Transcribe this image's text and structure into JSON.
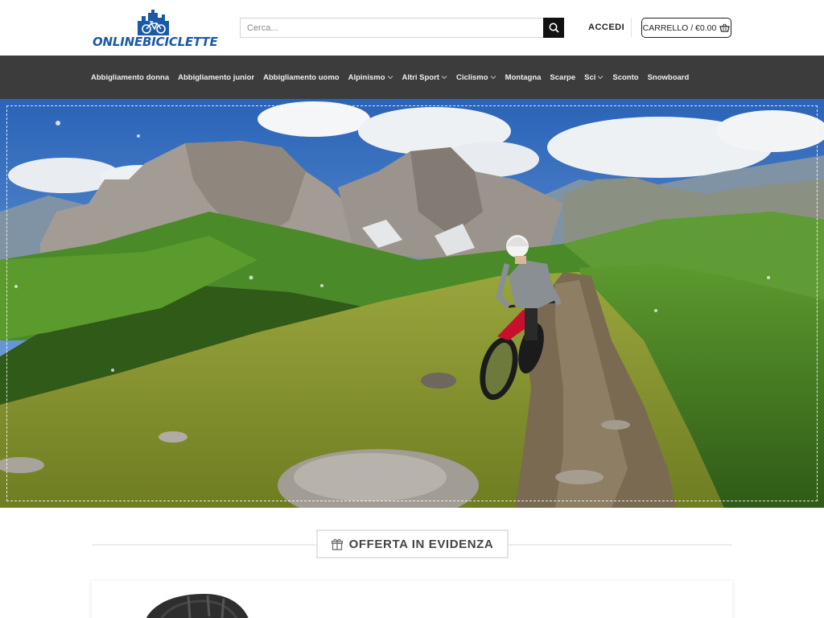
{
  "header": {
    "logo_text": "ONLINEBICICLETTE",
    "search_placeholder": "Cerca...",
    "login_label": "ACCEDI",
    "cart_label": "CARRELLO / €0.00"
  },
  "nav": {
    "items": [
      {
        "label": "Abbigliamento donna",
        "has_dropdown": false
      },
      {
        "label": "Abbigliamento junior",
        "has_dropdown": false
      },
      {
        "label": "Abbigliamento uomo",
        "has_dropdown": false
      },
      {
        "label": "Alpinismo",
        "has_dropdown": true
      },
      {
        "label": "Altri Sport",
        "has_dropdown": true
      },
      {
        "label": "Ciclismo",
        "has_dropdown": true
      },
      {
        "label": "Montagna",
        "has_dropdown": false
      },
      {
        "label": "Scarpe",
        "has_dropdown": false
      },
      {
        "label": "Sci",
        "has_dropdown": true
      },
      {
        "label": "Sconto",
        "has_dropdown": false
      },
      {
        "label": "Snowboard",
        "has_dropdown": false
      }
    ]
  },
  "featured": {
    "title": "OFFERTA IN EVIDENZA",
    "icon": "gift-icon"
  },
  "colors": {
    "brand_blue": "#1c58a8",
    "nav_bg": "#3c3c3c",
    "search_button": "#111111"
  },
  "icons": {
    "search": "search-icon",
    "cart": "basket-icon",
    "dropdown": "chevron-down-icon"
  }
}
